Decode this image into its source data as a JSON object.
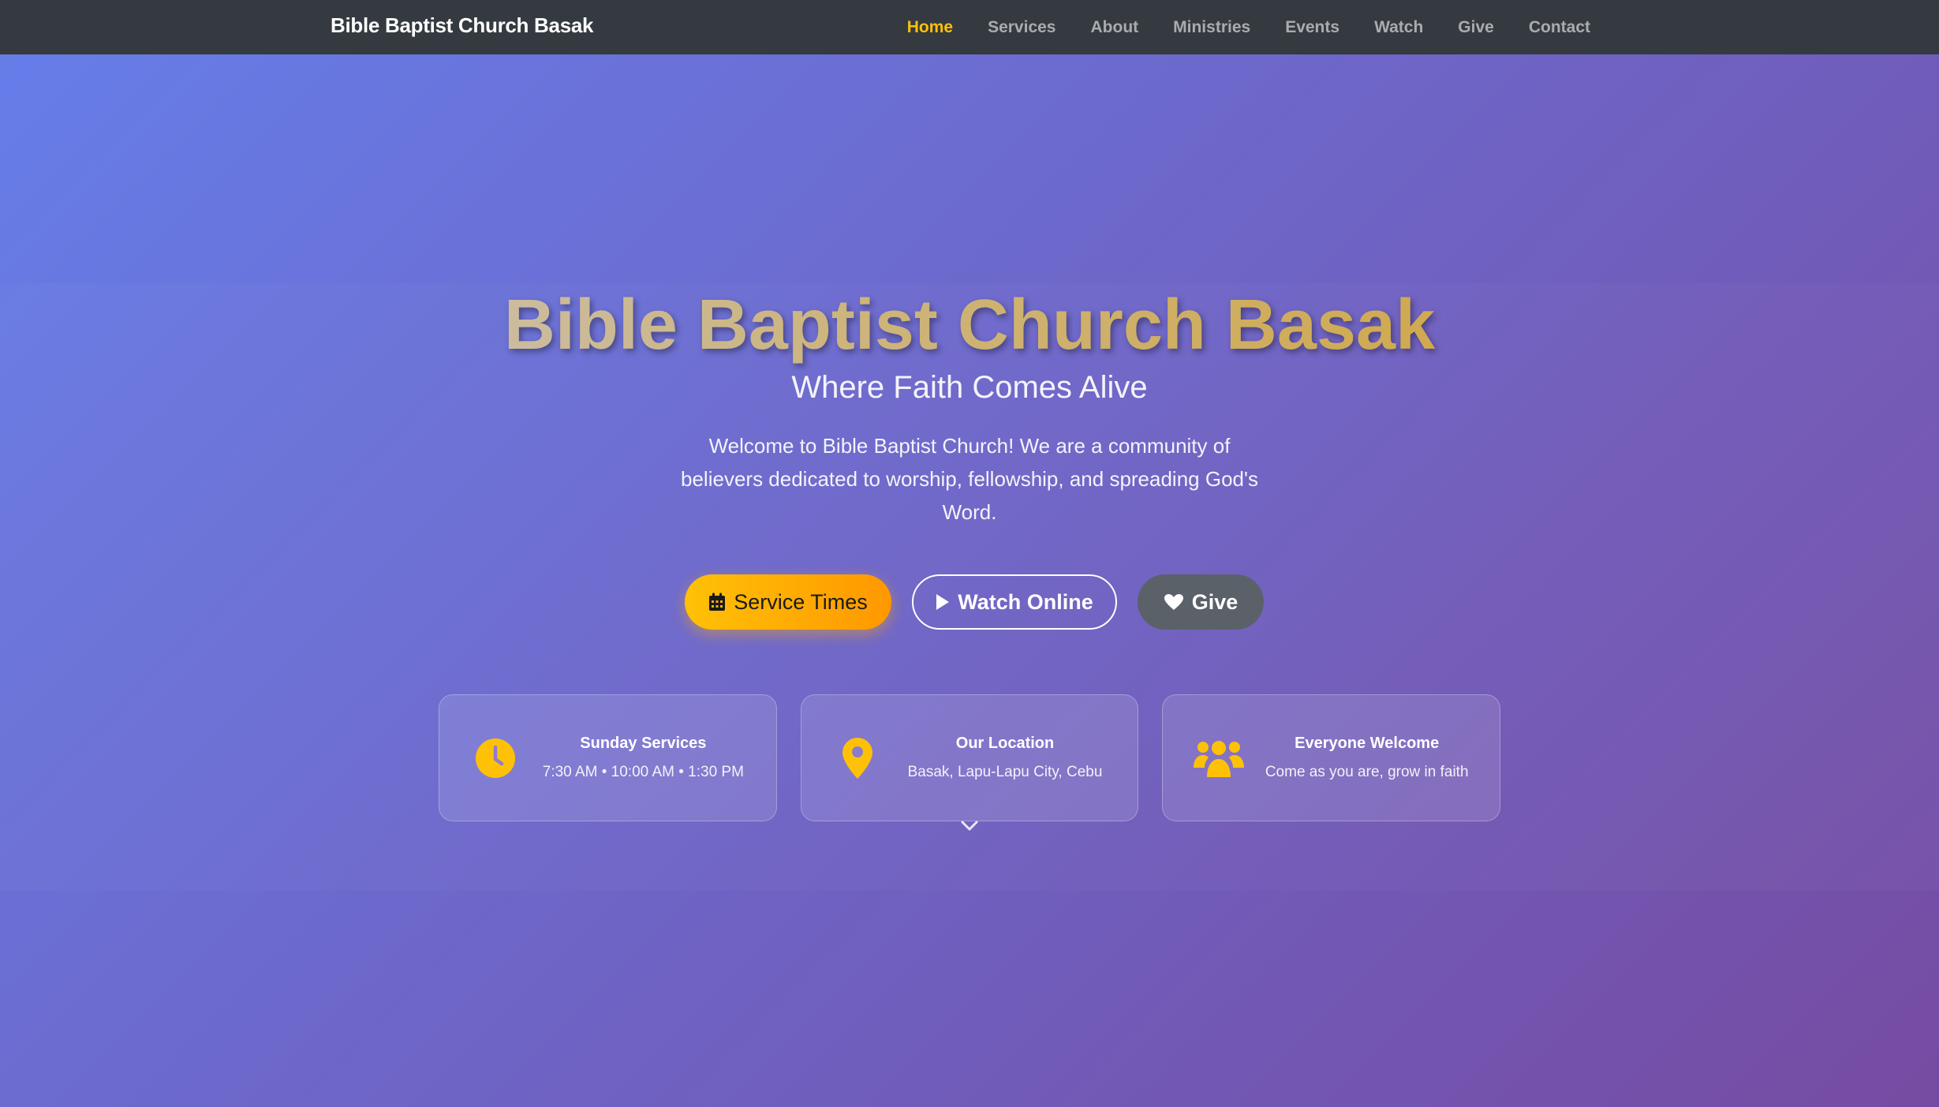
{
  "nav": {
    "brand": "Bible Baptist Church Basak",
    "links": [
      "Home",
      "Services",
      "About",
      "Ministries",
      "Events",
      "Watch",
      "Give",
      "Contact"
    ],
    "active": "Home"
  },
  "hero": {
    "title": "Bible Baptist Church Basak",
    "subtitle": "Where Faith Comes Alive",
    "description": "Welcome to Bible Baptist Church! We are a community of believers dedicated to worship, fellowship, and spreading God's Word."
  },
  "buttons": {
    "service_times": "Service Times",
    "watch_online": "Watch Online",
    "give": "Give"
  },
  "cards": [
    {
      "title": "Sunday Services",
      "sub": "7:30 AM • 10:00 AM • 1:30 PM",
      "icon": "clock-icon"
    },
    {
      "title": "Our Location",
      "sub": "Basak, Lapu-Lapu City, Cebu",
      "icon": "map-pin-icon"
    },
    {
      "title": "Everyone Welcome",
      "sub": "Come as you are, grow in faith",
      "icon": "users-icon"
    }
  ],
  "colors": {
    "accent": "#ffc107",
    "navbar": "#343a40",
    "gradient_start": "#667eea",
    "gradient_end": "#764ba2"
  }
}
